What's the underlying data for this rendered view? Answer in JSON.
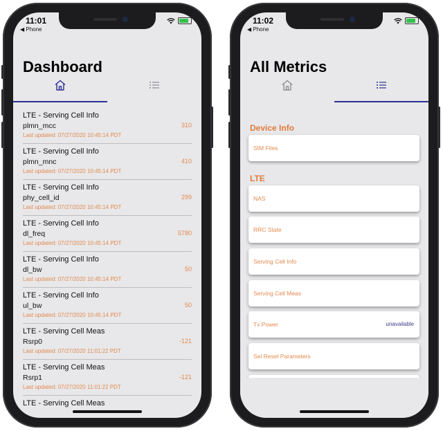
{
  "left": {
    "status": {
      "time": "11:01",
      "back": "◀ Phone"
    },
    "title": "Dashboard",
    "active_tab": 0,
    "rows": [
      {
        "header": "LTE - Serving Cell Info",
        "metric": "plmn_mcc",
        "updated": "Last updated: 07/27/2020 10:45:14 PDT",
        "value": "310"
      },
      {
        "header": "LTE - Serving Cell Info",
        "metric": "plmn_mnc",
        "updated": "Last updated: 07/27/2020 10:45:14 PDT",
        "value": "410"
      },
      {
        "header": "LTE - Serving Cell Info",
        "metric": "phy_cell_id",
        "updated": "Last updated: 07/27/2020 10:45:14 PDT",
        "value": "299"
      },
      {
        "header": "LTE - Serving Cell Info",
        "metric": "dl_freq",
        "updated": "Last updated: 07/27/2020 10:45:14 PDT",
        "value": "5780"
      },
      {
        "header": "LTE - Serving Cell Info",
        "metric": "dl_bw",
        "updated": "Last updated: 07/27/2020 10:45:14 PDT",
        "value": "50"
      },
      {
        "header": "LTE - Serving Cell Info",
        "metric": "ul_bw",
        "updated": "Last updated: 07/27/2020 10:45:14 PDT",
        "value": "50"
      },
      {
        "header": "LTE - Serving Cell Meas",
        "metric": "Rsrp0",
        "updated": "Last updated: 07/27/2020 11:01:22 PDT",
        "value": "-121"
      },
      {
        "header": "LTE - Serving Cell Meas",
        "metric": "Rsrp1",
        "updated": "Last updated: 07/27/2020 11:01:22 PDT",
        "value": "-121"
      },
      {
        "header": "LTE - Serving Cell Meas",
        "metric": "",
        "updated": "",
        "value": ""
      }
    ]
  },
  "right": {
    "status": {
      "time": "11:02",
      "back": "◀ Phone"
    },
    "title": "All Metrics",
    "active_tab": 1,
    "sections": [
      {
        "title": "Device Info",
        "items": [
          {
            "label": "SIM Files",
            "value": ""
          }
        ]
      },
      {
        "title": "LTE",
        "items": [
          {
            "label": "NAS",
            "value": ""
          },
          {
            "label": "RRC State",
            "value": ""
          },
          {
            "label": "Serving Cell Info",
            "value": ""
          },
          {
            "label": "Serving Cell Meas",
            "value": ""
          },
          {
            "label": "Tx Power",
            "value": "unavailable"
          },
          {
            "label": "Sel Resel Parameters",
            "value": ""
          }
        ]
      }
    ]
  },
  "colors": {
    "accent": "#2a2f8f",
    "orange": "#e07a3a",
    "value_orange": "#e2894d",
    "tab_inactive": "#8e8e93"
  },
  "icons": {
    "tab0": "home-icon",
    "tab1": "list-icon"
  }
}
